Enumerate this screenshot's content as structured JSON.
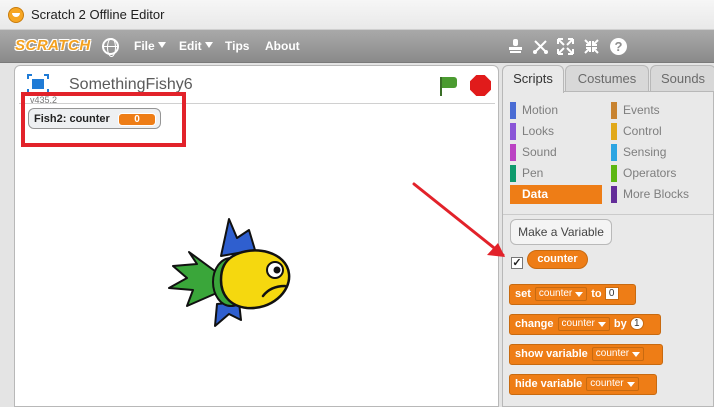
{
  "window": {
    "title": "Scratch 2 Offline Editor"
  },
  "menubar": {
    "logo": "SCRATCH",
    "items": [
      "File",
      "Edit",
      "Tips",
      "About"
    ]
  },
  "stage": {
    "project_title": "SomethingFishy6",
    "version": "v435.2",
    "monitor": {
      "label": "Fish2: counter",
      "value": "0"
    }
  },
  "tabs": [
    "Scripts",
    "Costumes",
    "Sounds"
  ],
  "categories": {
    "left": [
      {
        "label": "Motion",
        "color": "#4a6cd4"
      },
      {
        "label": "Looks",
        "color": "#8a55d7"
      },
      {
        "label": "Sound",
        "color": "#bb42c3"
      },
      {
        "label": "Pen",
        "color": "#0e9a6c"
      },
      {
        "label": "Data",
        "color": "#ee7d16",
        "active": true
      }
    ],
    "right": [
      {
        "label": "Events",
        "color": "#c88330"
      },
      {
        "label": "Control",
        "color": "#e1a91a"
      },
      {
        "label": "Sensing",
        "color": "#2ca5e2"
      },
      {
        "label": "Operators",
        "color": "#5cb712"
      },
      {
        "label": "More Blocks",
        "color": "#632d99"
      }
    ]
  },
  "data_palette": {
    "make_variable": "Make a Variable",
    "checkbox_mark": "✓",
    "reporter": "counter",
    "blocks": {
      "set": {
        "word": "set",
        "var": "counter",
        "to": "to",
        "value": "0"
      },
      "change": {
        "word": "change",
        "var": "counter",
        "by": "by",
        "value": "1"
      },
      "show": {
        "word": "show variable",
        "var": "counter"
      },
      "hide": {
        "word": "hide variable",
        "var": "counter"
      }
    }
  }
}
